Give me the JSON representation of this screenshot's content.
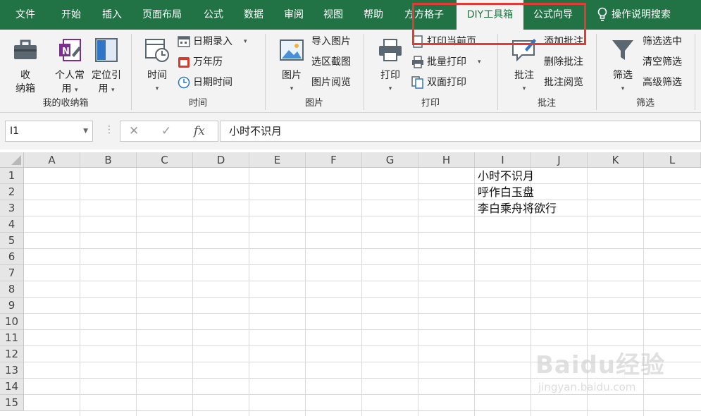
{
  "tabs": [
    {
      "label": "文件",
      "active": false
    },
    {
      "label": "开始",
      "active": false
    },
    {
      "label": "插入",
      "active": false
    },
    {
      "label": "页面布局",
      "active": false
    },
    {
      "label": "公式",
      "active": false
    },
    {
      "label": "数据",
      "active": false
    },
    {
      "label": "审阅",
      "active": false
    },
    {
      "label": "视图",
      "active": false
    },
    {
      "label": "帮助",
      "active": false
    },
    {
      "label": "方方格子",
      "active": false
    },
    {
      "label": "DIY工具箱",
      "active": true
    },
    {
      "label": "公式向导",
      "active": false
    }
  ],
  "tellme": "操作说明搜索",
  "ribbon": {
    "groups": [
      "我的收纳箱",
      "时间",
      "图片",
      "打印",
      "批注",
      "筛选"
    ],
    "storage": {
      "box": [
        "收",
        "纳箱"
      ],
      "personal": [
        "个人常",
        "用"
      ],
      "locate": [
        "定位引",
        "用"
      ]
    },
    "time": {
      "big": "时间",
      "date_entry": "日期录入",
      "calendar": "万年历",
      "datetime": "日期时间"
    },
    "image": {
      "big": "图片",
      "import": "导入图片",
      "screenshot": "选区截图",
      "browse": "图片阅览"
    },
    "print": {
      "big": "打印",
      "current": "打印当前页",
      "batch": "批量打印",
      "duplex": "双面打印"
    },
    "comment": {
      "big": "批注",
      "add": "添加批注",
      "delete": "删除批注",
      "browse": "批注阅览"
    },
    "filter": {
      "big": "筛选",
      "selected": "筛选选中",
      "clear": "清空筛选",
      "advanced": "高级筛选"
    }
  },
  "formula_bar": {
    "namebox": "I1",
    "fx": "fx",
    "value": "小时不识月"
  },
  "columns": [
    "A",
    "B",
    "C",
    "D",
    "E",
    "F",
    "G",
    "H",
    "I",
    "J",
    "K",
    "L"
  ],
  "rows": [
    "1",
    "2",
    "3",
    "4",
    "5",
    "6",
    "7",
    "8",
    "9",
    "10",
    "11",
    "12",
    "13",
    "14",
    "15"
  ],
  "cells": {
    "I1": "小时不识月",
    "I2": "呼作白玉盘",
    "I3": "李白乘舟将欲行"
  },
  "watermark": {
    "logo": "Baidu经验",
    "url": "jingyan.baidu.com"
  },
  "colors": {
    "accent": "#217346",
    "highlight": "#e53935"
  }
}
